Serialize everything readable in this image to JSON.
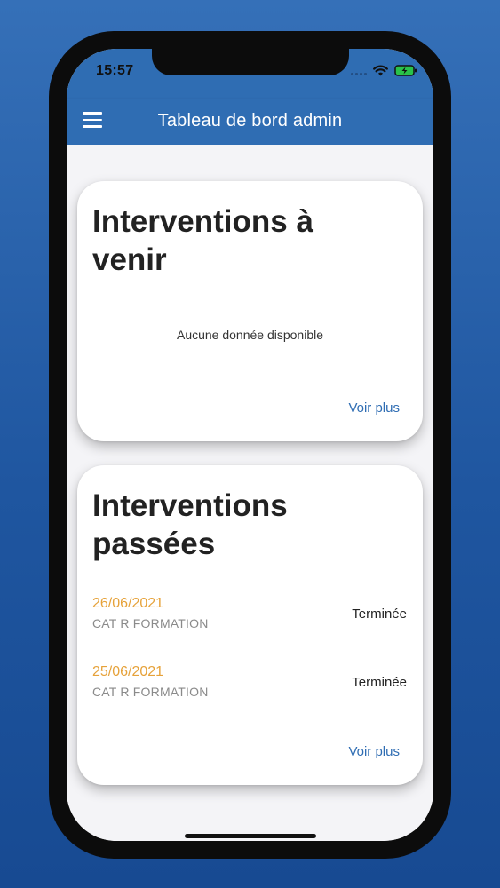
{
  "status_bar": {
    "time": "15:57"
  },
  "app_bar": {
    "title": "Tableau de bord admin"
  },
  "upcoming": {
    "title": "Interventions à venir",
    "empty_text": "Aucune donnée disponible",
    "more_label": "Voir plus"
  },
  "past": {
    "title": "Interventions passées",
    "items": [
      {
        "date": "26/06/2021",
        "name": "CAT R FORMATION",
        "status": "Terminée"
      },
      {
        "date": "25/06/2021",
        "name": "CAT R FORMATION",
        "status": "Terminée"
      }
    ],
    "more_label": "Voir plus"
  },
  "colors": {
    "primary": "#2f6db3",
    "date_accent": "#e6a23a",
    "background_gradient_top": "#3570b8",
    "background_gradient_bottom": "#174a92"
  },
  "icons": [
    "menu-icon",
    "wifi-icon",
    "battery-charging-icon",
    "signal-icon"
  ]
}
